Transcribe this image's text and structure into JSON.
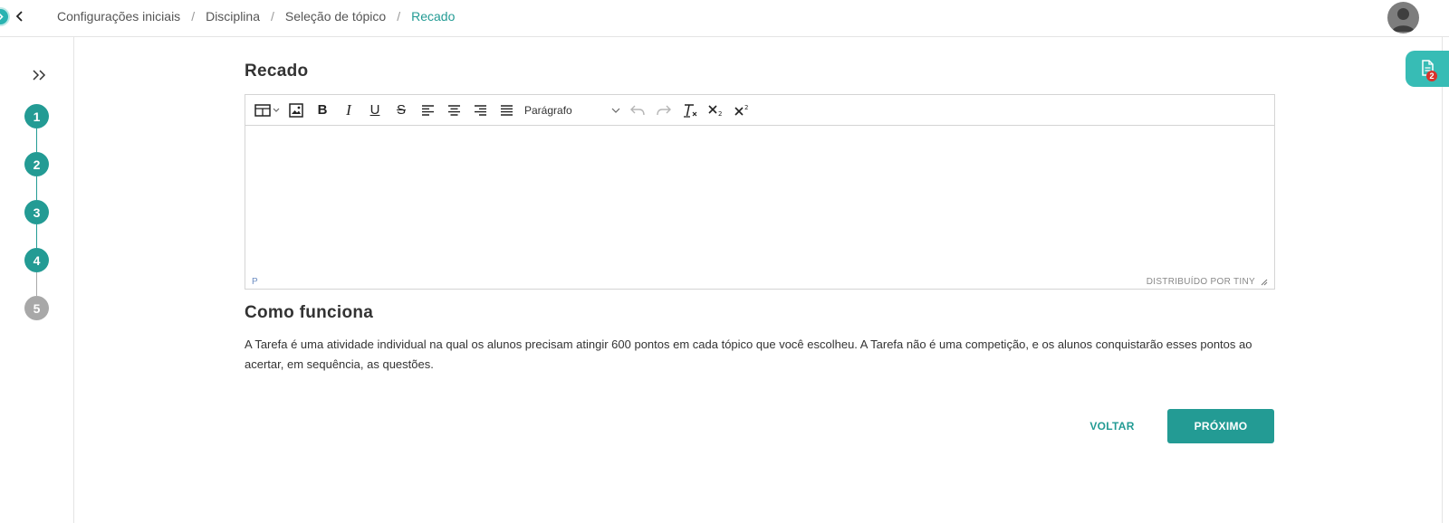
{
  "breadcrumb": {
    "items": [
      "Configurações iniciais",
      "Disciplina",
      "Seleção de tópico"
    ],
    "separator": "/",
    "current": "Recado"
  },
  "sidebar": {
    "steps": [
      {
        "number": "1",
        "status": "done"
      },
      {
        "number": "2",
        "status": "done"
      },
      {
        "number": "3",
        "status": "done"
      },
      {
        "number": "4",
        "status": "current"
      },
      {
        "number": "5",
        "status": "pending"
      }
    ]
  },
  "notes_panel": {
    "badge_count": "2"
  },
  "editor": {
    "title": "Recado",
    "block_format": "Parágrafo",
    "status_path": "P",
    "powered_by": "DISTRIBUÍDO POR TINY",
    "content": ""
  },
  "info": {
    "title": "Como funciona",
    "text": "A Tarefa é uma atividade individual na qual os alunos precisam atingir 600 pontos em cada tópico que você escolheu. A Tarefa não é uma competição, e os alunos conquistarão esses pontos ao acertar, em sequência, as questões."
  },
  "actions": {
    "back_label": "VOLTAR",
    "next_label": "PRÓXIMO"
  },
  "colors": {
    "primary": "#239b94",
    "accent_tab": "#37bcb5",
    "badge": "#d9322b",
    "inactive_step": "#a8a8a8"
  }
}
